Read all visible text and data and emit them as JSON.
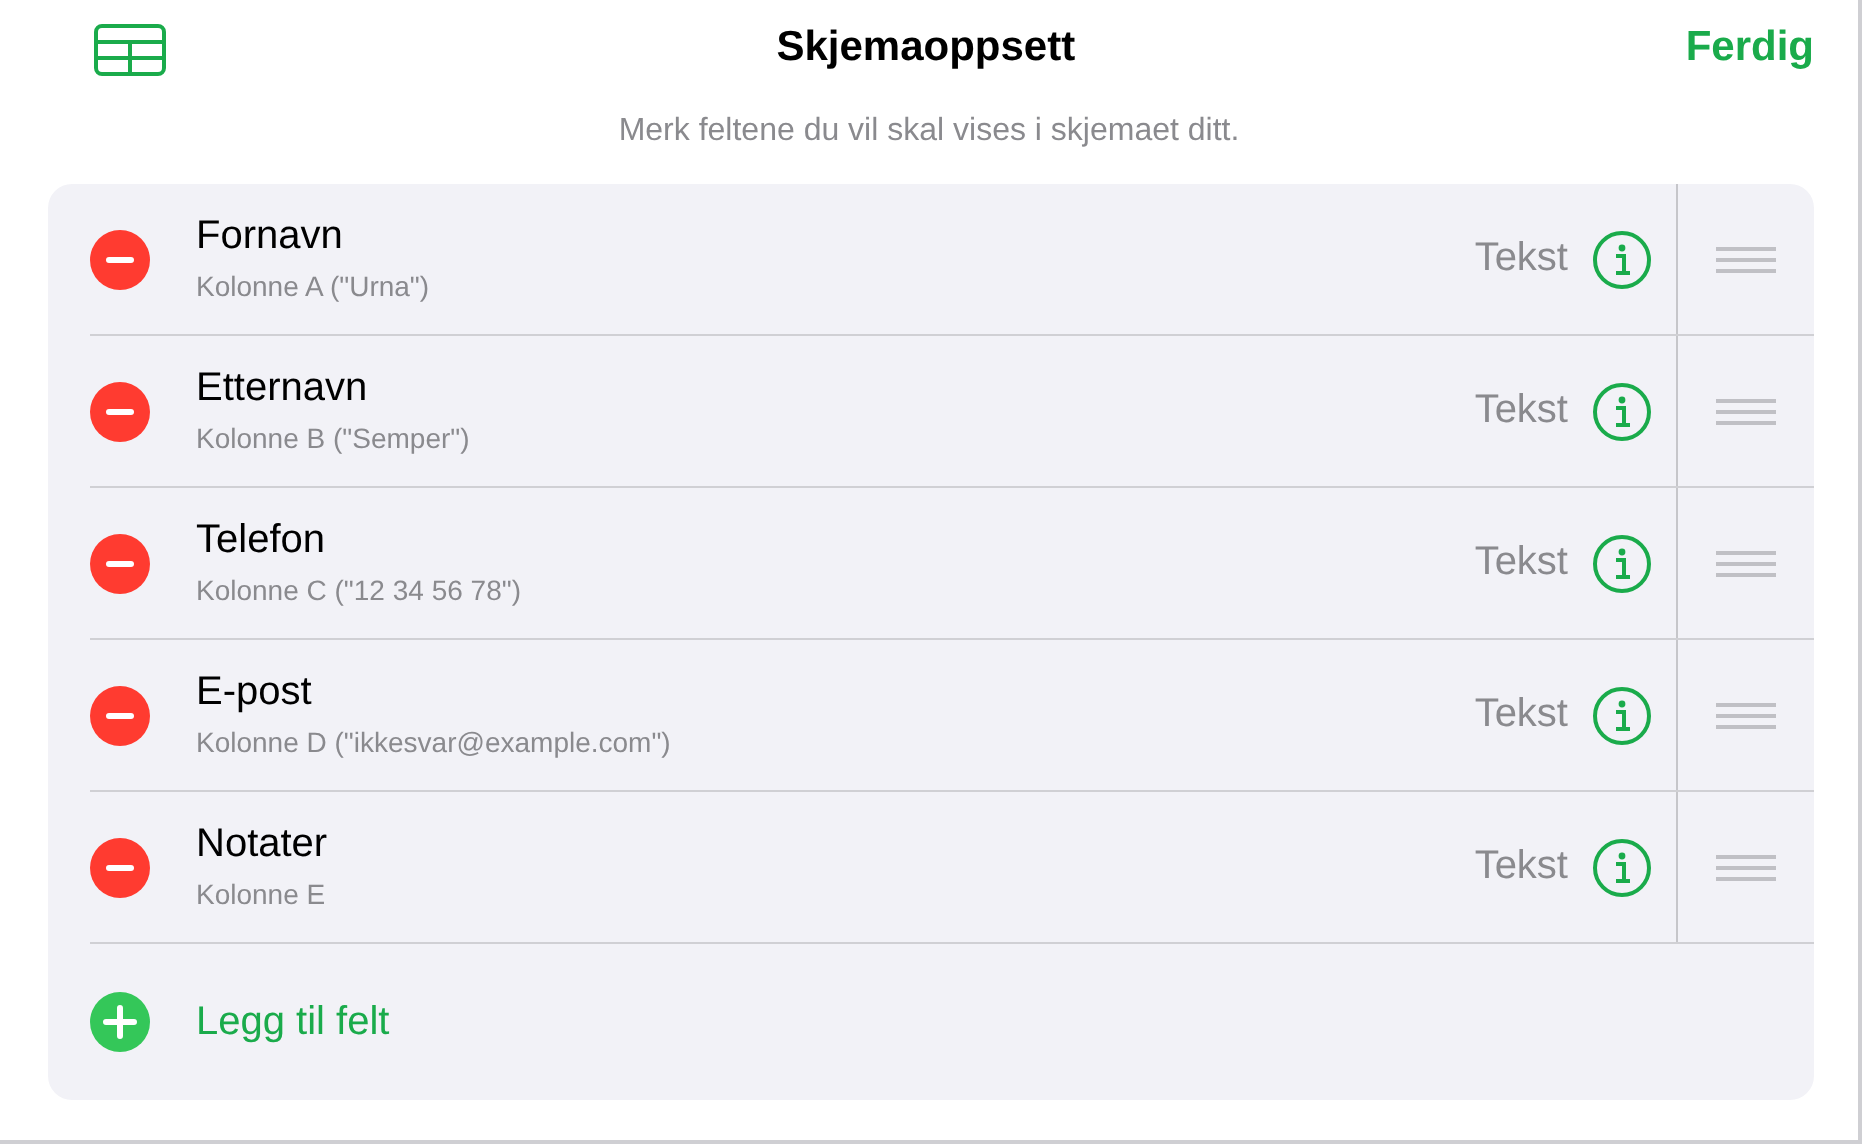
{
  "header": {
    "title": "Skjemaoppsett",
    "done_button": "Ferdig"
  },
  "instruction": "Merk feltene du vil skal vises i skjemaet ditt.",
  "fields": [
    {
      "name": "Fornavn",
      "source": "Kolonne A (\"Urna\")",
      "type": "Tekst"
    },
    {
      "name": "Etternavn",
      "source": "Kolonne B (\"Semper\")",
      "type": "Tekst"
    },
    {
      "name": "Telefon",
      "source": "Kolonne C (\"12 34 56 78\")",
      "type": "Tekst"
    },
    {
      "name": "E-post",
      "source": "Kolonne D (\"ikkesvar@example.com\")",
      "type": "Tekst"
    },
    {
      "name": "Notater",
      "source": "Kolonne E",
      "type": "Tekst"
    }
  ],
  "add_field": "Legg til felt"
}
